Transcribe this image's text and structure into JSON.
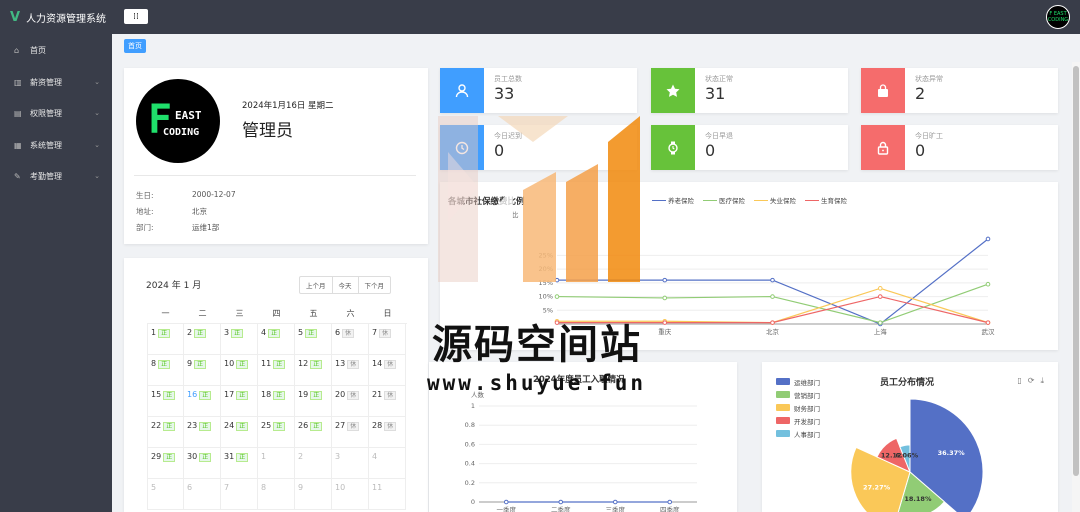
{
  "app": {
    "title": "人力资源管理系统",
    "menu_toggle": "⁞⁞"
  },
  "avatar": {
    "line1": "F EAST",
    "line2": "CODING"
  },
  "sidebar": {
    "items": [
      {
        "label": "首页",
        "icon": "home-icon",
        "glyph": "⌂"
      },
      {
        "label": "薪资管理",
        "icon": "salary-icon",
        "glyph": "▥",
        "arrow": "⌄"
      },
      {
        "label": "权限管理",
        "icon": "permission-icon",
        "glyph": "▤",
        "arrow": "⌄"
      },
      {
        "label": "系统管理",
        "icon": "system-icon",
        "glyph": "▦",
        "arrow": "⌄"
      },
      {
        "label": "考勤管理",
        "icon": "attendance-icon",
        "glyph": "✎",
        "arrow": "⌄"
      }
    ]
  },
  "breadcrumb": {
    "current": "首页"
  },
  "profile": {
    "logo": {
      "f": "F",
      "east": "EAST",
      "coding": "CODING"
    },
    "date": "2024年1月16日 星期二",
    "name": "管理员",
    "fields": [
      {
        "label": "生日:",
        "value": "2000-12-07"
      },
      {
        "label": "地址:",
        "value": "北京"
      },
      {
        "label": "部门:",
        "value": "运维1部"
      }
    ]
  },
  "calendar": {
    "title": "2024 年 1 月",
    "buttons": [
      "上个月",
      "今天",
      "下个月"
    ],
    "weekdays": [
      "一",
      "二",
      "三",
      "四",
      "五",
      "六",
      "日"
    ],
    "ok_tag": "正",
    "off_tag": "休",
    "days": [
      {
        "d": "1",
        "t": "ok"
      },
      {
        "d": "2",
        "t": "ok"
      },
      {
        "d": "3",
        "t": "ok"
      },
      {
        "d": "4",
        "t": "ok"
      },
      {
        "d": "5",
        "t": "ok"
      },
      {
        "d": "6",
        "t": "off"
      },
      {
        "d": "7",
        "t": "off"
      },
      {
        "d": "8",
        "t": "ok"
      },
      {
        "d": "9",
        "t": "ok"
      },
      {
        "d": "10",
        "t": "ok"
      },
      {
        "d": "11",
        "t": "ok"
      },
      {
        "d": "12",
        "t": "ok"
      },
      {
        "d": "13",
        "t": "off"
      },
      {
        "d": "14",
        "t": "off"
      },
      {
        "d": "15",
        "t": "ok"
      },
      {
        "d": "16",
        "t": "ok",
        "today": true
      },
      {
        "d": "17",
        "t": "ok"
      },
      {
        "d": "18",
        "t": "ok"
      },
      {
        "d": "19",
        "t": "ok"
      },
      {
        "d": "20",
        "t": "off"
      },
      {
        "d": "21",
        "t": "off"
      },
      {
        "d": "22",
        "t": "ok"
      },
      {
        "d": "23",
        "t": "ok"
      },
      {
        "d": "24",
        "t": "ok"
      },
      {
        "d": "25",
        "t": "ok"
      },
      {
        "d": "26",
        "t": "ok"
      },
      {
        "d": "27",
        "t": "off"
      },
      {
        "d": "28",
        "t": "off"
      },
      {
        "d": "29",
        "t": "ok"
      },
      {
        "d": "30",
        "t": "ok"
      },
      {
        "d": "31",
        "t": "ok"
      },
      {
        "d": "1",
        "other": true
      },
      {
        "d": "2",
        "other": true
      },
      {
        "d": "3",
        "other": true
      },
      {
        "d": "4",
        "other": true
      },
      {
        "d": "5",
        "other": true
      },
      {
        "d": "6",
        "other": true
      },
      {
        "d": "7",
        "other": true
      },
      {
        "d": "8",
        "other": true
      },
      {
        "d": "9",
        "other": true
      },
      {
        "d": "10",
        "other": true
      },
      {
        "d": "11",
        "other": true
      }
    ]
  },
  "stats": [
    {
      "label": "员工总数",
      "value": "33",
      "color": "#409eff",
      "icon": "user-icon"
    },
    {
      "label": "状态正常",
      "value": "31",
      "color": "#67c23a",
      "icon": "star-icon"
    },
    {
      "label": "状态异常",
      "value": "2",
      "color": "#f56c6c",
      "icon": "bag-icon"
    },
    {
      "label": "今日迟到",
      "value": "0",
      "color": "#409eff",
      "icon": "clock-icon"
    },
    {
      "label": "今日早退",
      "value": "0",
      "color": "#67c23a",
      "icon": "watch-icon"
    },
    {
      "label": "今日旷工",
      "value": "0",
      "color": "#f56c6c",
      "icon": "lock-icon"
    }
  ],
  "colors": {
    "blue": "#5470c6",
    "green": "#91cc75",
    "yellow": "#fac858",
    "red": "#ee6666",
    "cyan": "#73c0de"
  },
  "watermark": {
    "text": "源码空间站",
    "url": "www.shuyue.fun"
  },
  "chart_data": [
    {
      "type": "line",
      "title": "各城市社保缴费比例",
      "ylabel": "比",
      "categories": [
        "",
        "重庆",
        "北京",
        "上海",
        "武汉"
      ],
      "category_labels": [
        "",
        "重庆",
        "北京",
        "上海",
        "武汉"
      ],
      "yticks": [
        "25%",
        "20%",
        "15%",
        "10%",
        "5%"
      ],
      "ylim": [
        0,
        35
      ],
      "series": [
        {
          "name": "养老保险",
          "color": "#5470c6",
          "values": [
            16,
            16,
            16,
            0,
            31
          ]
        },
        {
          "name": "医疗保险",
          "color": "#91cc75",
          "values": [
            10,
            9.5,
            10,
            0.5,
            14.5
          ]
        },
        {
          "name": "失业保险",
          "color": "#fac858",
          "values": [
            1,
            1,
            0.5,
            13,
            0.5
          ]
        },
        {
          "name": "生育保险",
          "color": "#ee6666",
          "values": [
            0.5,
            0.5,
            0.5,
            10,
            0.5
          ]
        }
      ]
    },
    {
      "type": "line",
      "title": "2024年度员工入职情况",
      "ylabel": "人数",
      "categories": [
        "一季度",
        "二季度",
        "三季度",
        "四季度"
      ],
      "yticks": [
        "1",
        "0.8",
        "0.6",
        "0.4",
        "0.2",
        "0"
      ],
      "ylim": [
        0,
        1
      ],
      "values": [
        0,
        0,
        0,
        0
      ]
    },
    {
      "type": "pie",
      "title": "员工分布情况",
      "series": [
        {
          "name": "运维部门",
          "color": "#5470c6",
          "value": 36.37,
          "label": "36.37%"
        },
        {
          "name": "营销部门",
          "color": "#91cc75",
          "value": 18.18,
          "label": "18.18%"
        },
        {
          "name": "财务部门",
          "color": "#fac858",
          "value": 27.27,
          "label": "27.27%"
        },
        {
          "name": "开发部门",
          "color": "#ee6666",
          "value": 12.12,
          "label": "12.12%"
        },
        {
          "name": "人事部门",
          "color": "#73c0de",
          "value": 6.06,
          "label": "6.06%"
        }
      ]
    }
  ]
}
